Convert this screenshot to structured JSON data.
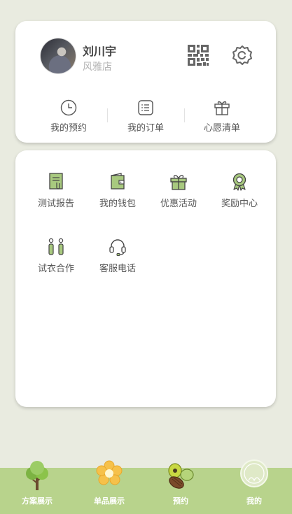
{
  "profile": {
    "name": "刘川宇",
    "store": "风雅店"
  },
  "quick_links": [
    {
      "label": "我的预约",
      "icon": "clock-icon"
    },
    {
      "label": "我的订单",
      "icon": "order-list-icon"
    },
    {
      "label": "心愿清单",
      "icon": "gift-icon"
    }
  ],
  "menu": [
    {
      "label": "测试报告",
      "icon": "report-icon"
    },
    {
      "label": "我的钱包",
      "icon": "wallet-icon"
    },
    {
      "label": "优惠活动",
      "icon": "gift-box-icon"
    },
    {
      "label": "奖励中心",
      "icon": "medal-icon"
    },
    {
      "label": "试衣合作",
      "icon": "people-icon"
    },
    {
      "label": "客服电话",
      "icon": "headset-icon"
    }
  ],
  "tabs": [
    {
      "label": "方案展示",
      "icon": "tree-icon"
    },
    {
      "label": "单品展示",
      "icon": "flower-icon"
    },
    {
      "label": "预约",
      "icon": "fruit-icon"
    },
    {
      "label": "我的",
      "icon": "profile-circle-icon"
    }
  ],
  "colors": {
    "background": "#e9ebe0",
    "accent_green": "#b8d38c",
    "icon_green": "#a8c97f",
    "icon_dark": "#555555"
  }
}
